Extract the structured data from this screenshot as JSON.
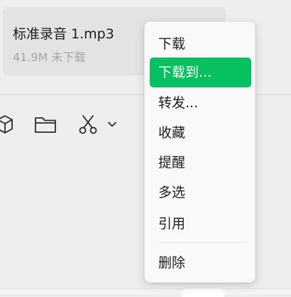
{
  "message": {
    "file_name": "标准录音 1.mp3",
    "file_meta": "41.9M 未下载"
  },
  "toolbar": {
    "icons": [
      "box-icon",
      "folder-icon",
      "scissors-icon",
      "chevron-down-icon"
    ]
  },
  "context_menu": {
    "items": [
      {
        "label": "下载"
      },
      {
        "label": "下载到..."
      },
      {
        "label": "转发..."
      },
      {
        "label": "收藏"
      },
      {
        "label": "提醒"
      },
      {
        "label": "多选"
      },
      {
        "label": "引用"
      },
      {
        "label": "删除"
      }
    ],
    "highlighted_label": "下载到..."
  },
  "colors": {
    "highlight": "#07c160",
    "background": "#eeeeee",
    "bubble": "#e3e3e3",
    "menu_background": "#f9f9f9",
    "text_primary": "#1e1e1e",
    "text_secondary": "#a6a6a6",
    "file_icon_accent": "#6d66e6"
  }
}
